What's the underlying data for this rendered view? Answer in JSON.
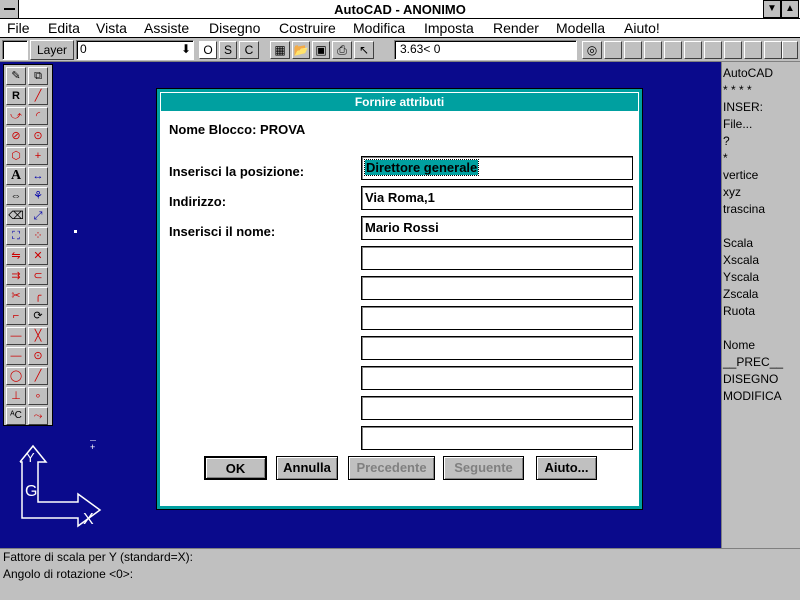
{
  "window": {
    "title": "AutoCAD - ANONIMO"
  },
  "menu": [
    "File",
    "Edita",
    "Vista",
    "Assiste",
    "Disegno",
    "Costruire",
    "Modifica",
    "Imposta",
    "Render",
    "Modella",
    "Aiuto!"
  ],
  "toolbar": {
    "layer_label": "Layer",
    "layer_value": "0",
    "ortho": "O",
    "snap": "S",
    "coords_toggle": "C",
    "coords": "3.63< 0"
  },
  "side_menu": [
    "AutoCAD",
    "* * * *",
    "INSER:",
    "File...",
    "?",
    "*",
    "vertice",
    "xyz",
    "trascina",
    "",
    "Scala",
    "Xscala",
    "Yscala",
    "Zscala",
    "Ruota",
    "",
    "Nome",
    "__PREC__",
    "DISEGNO",
    "MODIFICA"
  ],
  "command_line": [
    "Fattore di scala per Y (standard=X):",
    "Angolo di rotazione <0>:"
  ],
  "dialog": {
    "title": "Fornire attributi",
    "block_name_label": "Nome Blocco:",
    "block_name": "PROVA",
    "fields": [
      {
        "label": "Inserisci la posizione:",
        "value": "Direttore generale"
      },
      {
        "label": "Indirizzo:",
        "value": "Via Roma,1"
      },
      {
        "label": "Inserisci il nome:",
        "value": "Mario Rossi"
      },
      {
        "label": "",
        "value": ""
      },
      {
        "label": "",
        "value": ""
      },
      {
        "label": "",
        "value": ""
      },
      {
        "label": "",
        "value": ""
      },
      {
        "label": "",
        "value": ""
      },
      {
        "label": "",
        "value": ""
      },
      {
        "label": "",
        "value": ""
      }
    ],
    "buttons": {
      "ok": "OK",
      "cancel": "Annulla",
      "previous": "Precedente",
      "next": "Seguente",
      "help": "Aiuto..."
    }
  },
  "ucs_icon": {
    "y_label": "Y",
    "x_label": "X",
    "g_label": "G"
  }
}
